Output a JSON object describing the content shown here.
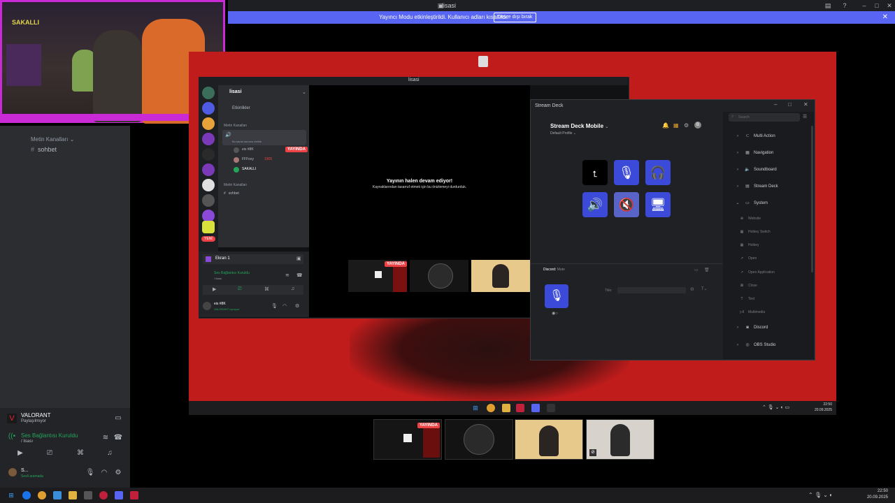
{
  "window": {
    "title": "lisasi"
  },
  "banner": {
    "message": "Yayıncı Modu etkinleştirildi. Kullanıcı adları kısaltıldı.",
    "button": "Devre dışı bırak"
  },
  "webcam": {
    "sign": "SAKALLI"
  },
  "sidebar": {
    "text_category": "Metin Kanalları",
    "text_channel": "sohbet"
  },
  "user_panel": {
    "activity_title": "VALORANT",
    "activity_status": "Paylaşılmıyor",
    "voice_status": "Ses Bağlantısı Kuruldu",
    "voice_channel": "/ lisası",
    "username": "S...",
    "user_status": "Sesli aramada"
  },
  "inner_discord": {
    "title": "lisasi",
    "server": "lisasi",
    "events": "Etkinlikler",
    "text_category": "Metin Kanalları",
    "voice_channel_desc": "Bu kanal durumu belirle",
    "members": [
      {
        "name": "eis #8K",
        "badge": "YAYINDA"
      },
      {
        "name": "FFFoxy",
        "extra": "1905"
      },
      {
        "name": "SAKALLI"
      }
    ],
    "text_category2": "Metin Kanalları",
    "text_channel": "sohbet",
    "screen_label": "Ekran 1",
    "voice_status": "Ses Bağlantısı Kuruldu",
    "voice_channel": "/ lisası",
    "username": "eis #8K",
    "user_status": "VALORANT oynuyor",
    "stream_message": "Yayının halen devam ediyor!",
    "stream_submessage": "Kaynaklarından tasarruf etmek için bu önizlemeyi durdurduk.",
    "live_badge": "YAYINDA",
    "guild_tag": "YENİ"
  },
  "stream_deck": {
    "window_title": "Stream Deck",
    "profile_name": "Stream Deck Mobile",
    "profile_sub": "Default Profile",
    "search_placeholder": "Search",
    "action_label": "Discord:",
    "action_value": "Mute",
    "title_label": "Title:",
    "categories": [
      "Multi Action",
      "Navigation",
      "Soundboard",
      "Stream Deck",
      "System"
    ],
    "system_items": [
      "Website",
      "Hotkey Switch",
      "Hotkey",
      "Open",
      "Open Application",
      "Close",
      "Text",
      "Multimedia"
    ],
    "bottom_categories": [
      "Discord",
      "OBS Studio"
    ]
  },
  "inner_clock": {
    "time": "22:50",
    "date": "20.09.2025"
  },
  "clock": {
    "time": "22:50",
    "date": "20.09.2025"
  },
  "thumb_live": "YAYINDA",
  "colors": {
    "accent": "#5865f2",
    "deck_key": "#3b4ad9",
    "live": "#ed4245",
    "stream_bg": "#c01c1c",
    "webcam_frame": "#c92ad6"
  }
}
